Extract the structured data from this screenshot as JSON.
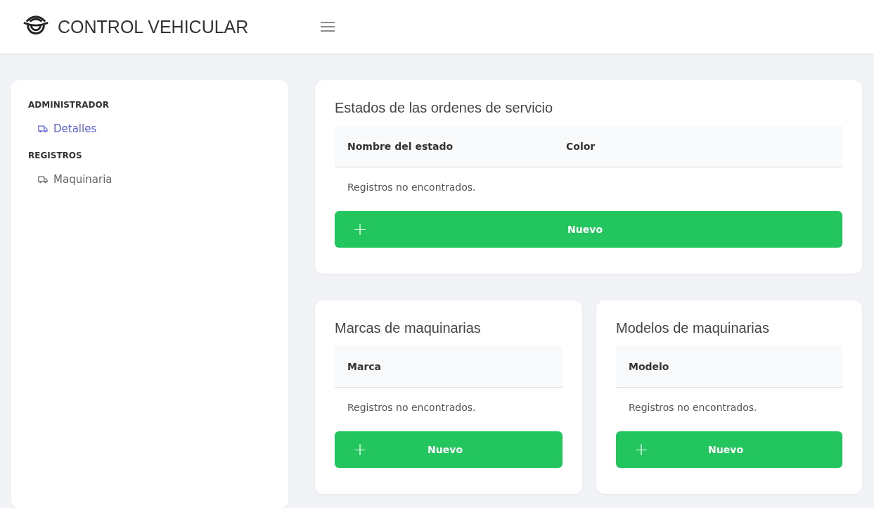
{
  "header": {
    "title": "CONTROL VEHICULAR"
  },
  "sidebar": {
    "sections": [
      {
        "heading": "ADMINISTRADOR",
        "items": [
          {
            "label": "Detalles",
            "selected": true
          }
        ]
      },
      {
        "heading": "REGISTROS",
        "items": [
          {
            "label": "Maquinaria",
            "selected": false
          }
        ]
      }
    ]
  },
  "panels": [
    {
      "title": "Estados de las ordenes de servicio",
      "columns": [
        "Nombre del estado",
        "Color"
      ],
      "empty_message": "Registros no encontrados.",
      "button": {
        "icon": "+",
        "label": "Nuevo"
      }
    },
    {
      "title": "Marcas de maquinarias",
      "columns": [
        "Marca"
      ],
      "empty_message": "Registros no encontrados.",
      "button": {
        "icon": "+",
        "label": "Nuevo"
      }
    },
    {
      "title": "Modelos de maquinarias",
      "columns": [
        "Modelo"
      ],
      "empty_message": "Registros no encontrados.",
      "button": {
        "icon": "+",
        "label": "Nuevo"
      }
    }
  ]
}
